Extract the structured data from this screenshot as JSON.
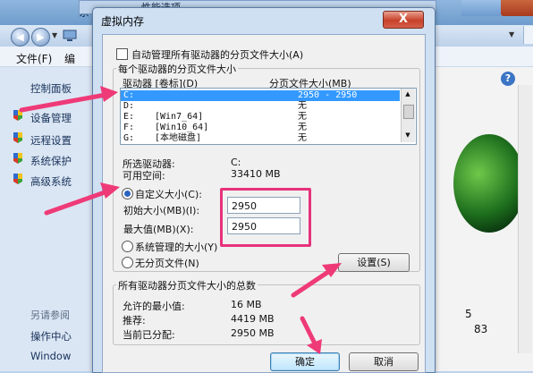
{
  "background": {
    "menu": [
      "文件(F)",
      "编"
    ],
    "left_nav": [
      {
        "label": "控制面板",
        "icon": "none"
      },
      {
        "label": "设备管理",
        "icon": "shield-icon"
      },
      {
        "label": "远程设置",
        "icon": "shield-icon"
      },
      {
        "label": "系统保护",
        "icon": "shield-icon"
      },
      {
        "label": "高级系统",
        "icon": "shield-icon"
      }
    ],
    "see_also": "另请参阅",
    "links": [
      "操作中心",
      "Window"
    ],
    "title_partial": "系",
    "right_numbers": [
      "5",
      "83"
    ]
  },
  "perf_dialog_title": "性能选项",
  "dialog": {
    "title": "虚拟内存",
    "close_label": "X",
    "auto_manage_label": "自动管理所有驱动器的分页文件大小(A)",
    "auto_manage_checked": false,
    "group_title": "每个驱动器的分页文件大小",
    "columns": {
      "drive": "驱动器 [卷标](D)",
      "size": "分页文件大小(MB)"
    },
    "drives": [
      {
        "drive": "C:",
        "label": "",
        "size": "2950 - 2950",
        "selected": true
      },
      {
        "drive": "D:",
        "label": "",
        "size": "无",
        "selected": false
      },
      {
        "drive": "E:",
        "label": "[Win7_64]",
        "size": "无",
        "selected": false
      },
      {
        "drive": "F:",
        "label": "[Win10_64]",
        "size": "无",
        "selected": false
      },
      {
        "drive": "G:",
        "label": "[本地磁盘]",
        "size": "无",
        "selected": false
      }
    ],
    "selected_drive_label": "所选驱动器:",
    "selected_drive_value": "C:",
    "free_space_label": "可用空间:",
    "free_space_value": "33410 MB",
    "custom_size_label": "自定义大小(C):",
    "initial_size_label": "初始大小(MB)(I):",
    "initial_size_value": "2950",
    "max_size_label": "最大值(MB)(X):",
    "max_size_value": "2950",
    "system_managed_label": "系统管理的大小(Y)",
    "no_paging_label": "无分页文件(N)",
    "set_button": "设置(S)",
    "total_group_title": "所有驱动器分页文件大小的总数",
    "min_allowed_label": "允许的最小值:",
    "min_allowed_value": "16 MB",
    "recommended_label": "推荐:",
    "recommended_value": "4419 MB",
    "current_label": "当前已分配:",
    "current_value": "2950 MB",
    "ok_button": "确定",
    "cancel_button": "取消"
  },
  "colors": {
    "highlight": "#3399ff",
    "annotation": "#ef3a78"
  }
}
